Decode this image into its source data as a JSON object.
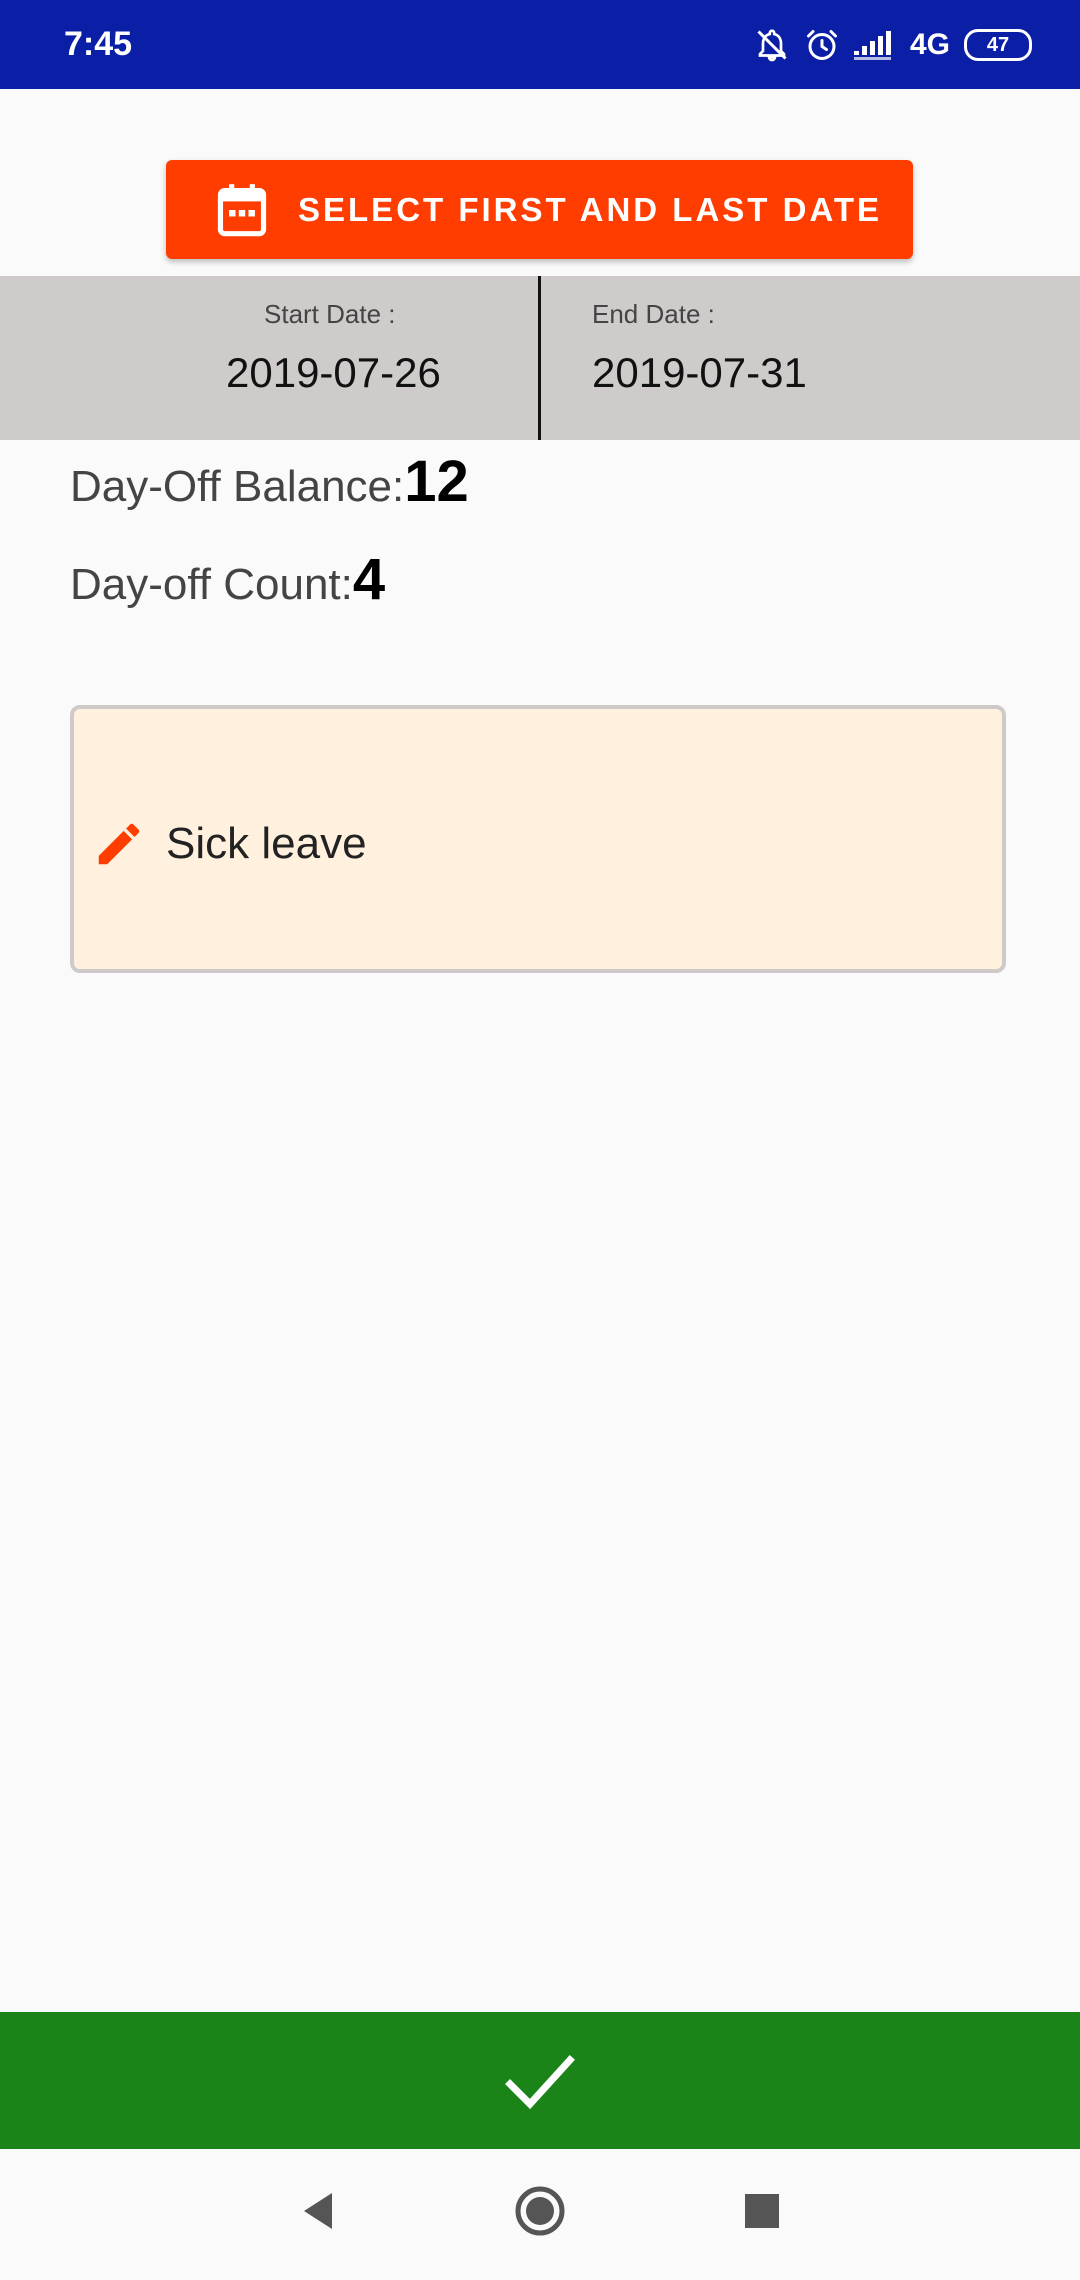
{
  "status_bar": {
    "time": "7:45",
    "network": "4G",
    "battery": "47",
    "icons": [
      "notifications-off-icon",
      "alarm-icon",
      "signal-icon",
      "battery-icon"
    ]
  },
  "actions": {
    "select_dates_label": "SELECT FIRST AND LAST DATE",
    "confirm_icon": "check-icon"
  },
  "date_range": {
    "start_label": "Start Date :",
    "start_value": "2019-07-26",
    "end_label": "End Date :",
    "end_value": "2019-07-31"
  },
  "stats": {
    "balance_label": "Day-Off Balance:",
    "balance_value": "12",
    "count_label": "Day-off Count:",
    "count_value": "4"
  },
  "reason": {
    "value": "Sick leave",
    "icon": "pencil-icon"
  },
  "colors": {
    "status_bar": "#0a1fa6",
    "accent": "#ff3d00",
    "range_panel": "#d0cbcb",
    "reason_background": "#fff1de",
    "confirm": "#1b8418"
  },
  "nav": {
    "icons": [
      "back-icon",
      "home-icon",
      "recents-icon"
    ]
  }
}
